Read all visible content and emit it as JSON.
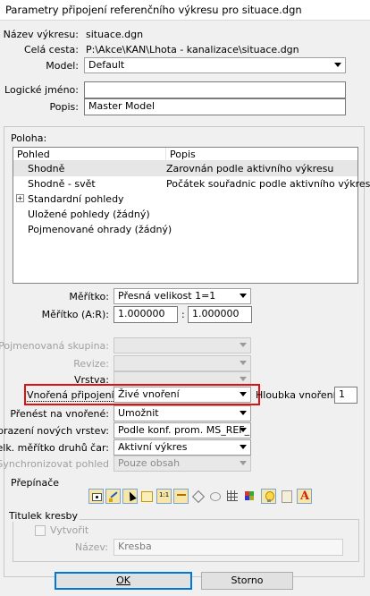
{
  "window": {
    "title": "Parametry připojení referenčního výkresu pro situace.dgn"
  },
  "form": {
    "nazev_label": "Název výkresu:",
    "nazev_value": "situace.dgn",
    "cesta_label": "Celá cesta:",
    "cesta_value": "P:\\Akce\\KAN\\Lhota - kanalizace\\situace.dgn",
    "model_label": "Model:",
    "model_value": "Default",
    "logicke_label": "Logické jméno:",
    "logicke_value": "",
    "popis_label": "Popis:",
    "popis_value": "Master Model"
  },
  "poloha": {
    "title": "Poloha:",
    "columns": [
      "Pohled",
      "Popis"
    ],
    "rows": [
      {
        "name": "Shodně",
        "desc": "Zarovnán podle aktivního výkresu"
      },
      {
        "name": "Shodně - svět",
        "desc": "Počátek souřadnic podle aktivního výkresu"
      },
      {
        "name": "Standardní pohledy",
        "desc": "",
        "expander": "+"
      },
      {
        "name": "Uložené pohledy (žádný)",
        "desc": ""
      },
      {
        "name": "Pojmenované ohrady (žádný)",
        "desc": ""
      }
    ]
  },
  "scale": {
    "meritko_label": "Měřítko:",
    "meritko_value": "Přesná velikost 1=1",
    "ar_label": "Měřítko (A:R):",
    "a_value": "1.000000",
    "sep": ":",
    "r_value": "1.000000"
  },
  "attach": {
    "skupina_label": "Pojmenovaná skupina:",
    "revize_label": "Revize:",
    "vrstva_label": "Vrstva:",
    "vnorena_label": "Vnořená připojení:",
    "vnorena_value": "Živé vnoření",
    "hloubka_label": "Hloubka vnoření:",
    "hloubka_value": "1",
    "prenest_label": "Přenést na vnořené:",
    "prenest_value": "Umožnit",
    "zobrazeni_label": "Zobrazení nových vrstev:",
    "zobrazeni_value": "Podle konf. prom. MS_REF_N",
    "celk_label": "Celk. měřítko druhů čar:",
    "celk_value": "Aktivní výkres",
    "sync_label": "Synchronizovat pohled",
    "sync_value": "Pouze obsah"
  },
  "prepinace": {
    "title": "Přepínače",
    "icons": [
      "display-icon",
      "snap-icon",
      "locate-icon",
      "clip-icon",
      "scale-lines-icon",
      "line-style-icon",
      "reference-icon",
      "treat-as-element-icon",
      "grid-icon",
      "color-table-icon",
      "lightbulb-icon",
      "template-icon",
      "annotation-icon"
    ]
  },
  "titulek": {
    "title": "Titulek kresby",
    "vytvorit_label": "Vytvořit",
    "nazev_label": "Název:",
    "nazev_value": "Kresba"
  },
  "buttons": {
    "ok": "OK",
    "storno": "Storno"
  }
}
